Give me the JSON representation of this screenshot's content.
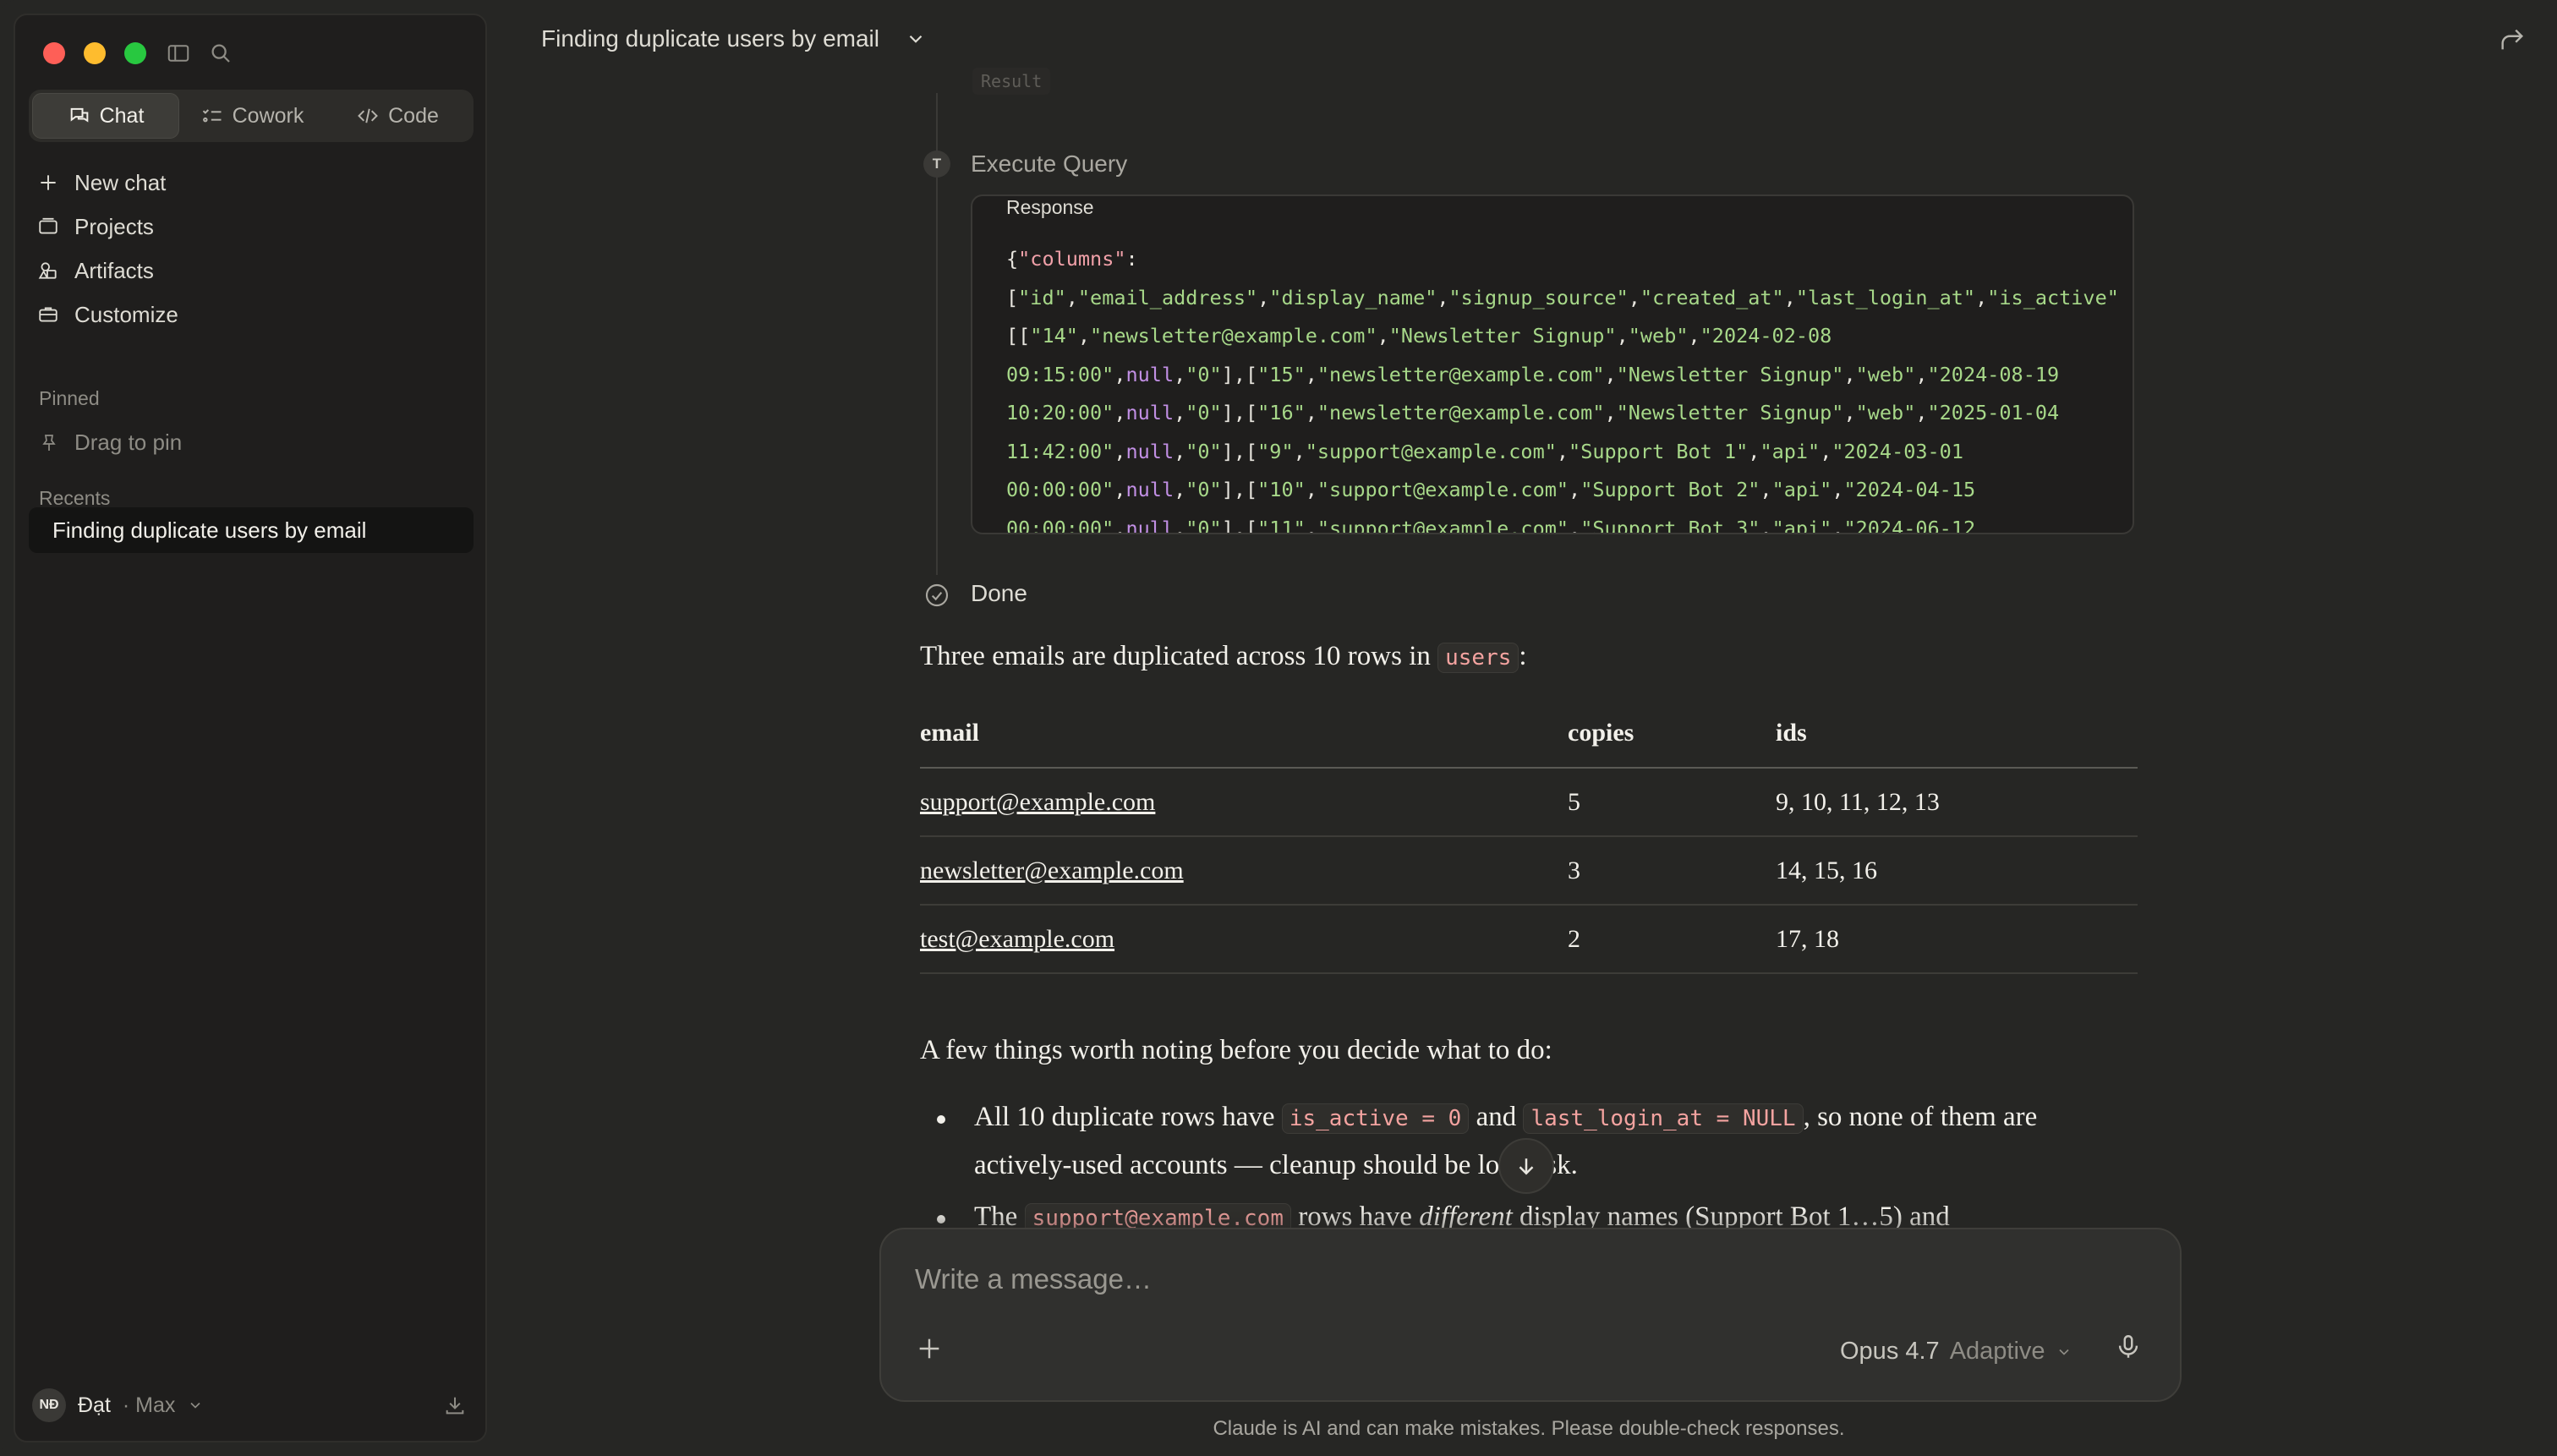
{
  "sidebar": {
    "modes": [
      {
        "label": "Chat",
        "icon": "chat-bubbles-icon",
        "active": true
      },
      {
        "label": "Cowork",
        "icon": "checklist-icon",
        "active": false
      },
      {
        "label": "Code",
        "icon": "code-icon",
        "active": false
      }
    ],
    "nav": [
      {
        "label": "New chat",
        "icon": "plus-icon"
      },
      {
        "label": "Projects",
        "icon": "folder-icon"
      },
      {
        "label": "Artifacts",
        "icon": "shapes-icon"
      },
      {
        "label": "Customize",
        "icon": "briefcase-icon"
      }
    ],
    "pinned_label": "Pinned",
    "pin_hint": "Drag to pin",
    "recents_label": "Recents",
    "recents": [
      "Finding duplicate users by email"
    ],
    "user": {
      "initials": "NĐ",
      "name": "Đạt",
      "plan": "· Max"
    }
  },
  "header": {
    "title": "Finding duplicate users by email"
  },
  "tool": {
    "result_tag": "Result",
    "step_badge": "T",
    "step_label": "Execute Query",
    "response_label": "Response",
    "done_label": "Done"
  },
  "message": {
    "intro_prefix": "Three emails are duplicated across 10 rows in ",
    "intro_code": "users",
    "intro_suffix": ":",
    "table": {
      "headers": [
        "email",
        "copies",
        "ids"
      ],
      "rows": [
        [
          "support@example.com",
          "5",
          "9, 10, 11, 12, 13"
        ],
        [
          "newsletter@example.com",
          "3",
          "14, 15, 16"
        ],
        [
          "test@example.com",
          "2",
          "17, 18"
        ]
      ]
    },
    "notes_intro": "A few things worth noting before you decide what to do:",
    "bullet1": {
      "a": "All 10 duplicate rows have ",
      "code1": "is_active = 0",
      "b": " and ",
      "code2": "last_login_at = NULL",
      "c": ", so none of them are actively-used accounts — cleanup should be low-risk."
    },
    "bullet2": {
      "a": "The ",
      "code1": "support@example.com",
      "b": " rows have ",
      "em": "different",
      "c": " display names (Support Bot 1…5) and"
    }
  },
  "composer": {
    "placeholder": "Write a message…",
    "model": "Opus 4.7",
    "mode": "Adaptive"
  },
  "footer": {
    "disclaimer": "Claude is AI and can make mistakes. Please double-check responses."
  },
  "colors": {
    "background": "#262624",
    "sidebar": "#1f1e1d",
    "code_key": "#f0a0a8",
    "code_string": "#a7d889",
    "code_null": "#c18fe4",
    "inline_code": "#f4a3a0"
  }
}
